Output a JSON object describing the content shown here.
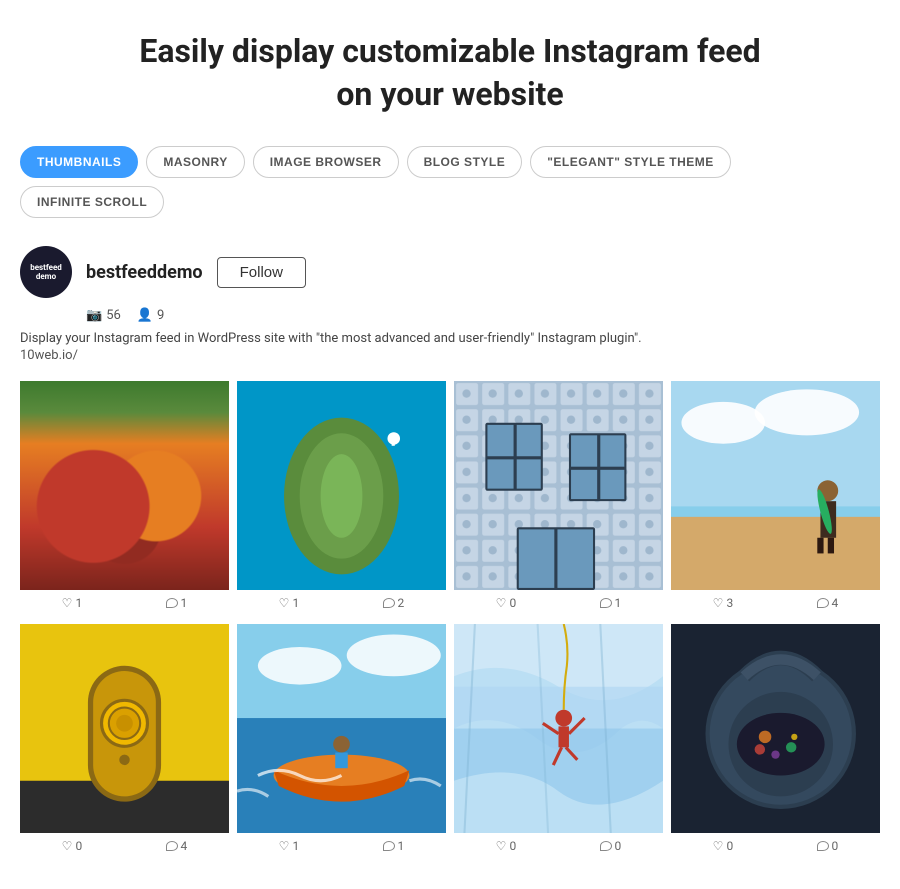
{
  "headline": {
    "line1": "Easily display customizable Instagram feed",
    "line2": "on your website"
  },
  "tabs": [
    {
      "id": "thumbnails",
      "label": "THUMBNAILS",
      "active": true
    },
    {
      "id": "masonry",
      "label": "MASONRY",
      "active": false
    },
    {
      "id": "image-browser",
      "label": "IMAGE BROWSER",
      "active": false
    },
    {
      "id": "blog-style",
      "label": "BLOG STYLE",
      "active": false
    },
    {
      "id": "elegant-style",
      "label": "\"ELEGANT\" STYLE THEME",
      "active": false
    },
    {
      "id": "infinite-scroll",
      "label": "INFINITE SCROLL",
      "active": false
    }
  ],
  "profile": {
    "avatar_text": "bestfeed\ndemo",
    "username": "bestfeeddemo",
    "follow_label": "Follow",
    "posts_count": "56",
    "followers_count": "9",
    "bio": "Display your Instagram feed in WordPress site with \"the most advanced and user-friendly\" Instagram plugin\".",
    "link": "10web.io/"
  },
  "images": [
    {
      "id": "pumpkin",
      "css_class": "img-pumpkin",
      "likes": "1",
      "comments": "1"
    },
    {
      "id": "aerial",
      "css_class": "img-aerial",
      "likes": "1",
      "comments": "2"
    },
    {
      "id": "building",
      "css_class": "img-building",
      "likes": "0",
      "comments": "1"
    },
    {
      "id": "surfer",
      "css_class": "img-surfer",
      "likes": "3",
      "comments": "4"
    },
    {
      "id": "door",
      "css_class": "img-door",
      "likes": "0",
      "comments": "4"
    },
    {
      "id": "boat",
      "css_class": "img-boat",
      "likes": "1",
      "comments": "1"
    },
    {
      "id": "climber",
      "css_class": "img-climber",
      "likes": "0",
      "comments": "0"
    },
    {
      "id": "teapot",
      "css_class": "img-teapot",
      "likes": "0",
      "comments": "0"
    }
  ],
  "icons": {
    "camera": "📷",
    "person": "👤",
    "heart": "♡",
    "comment": "💬"
  }
}
